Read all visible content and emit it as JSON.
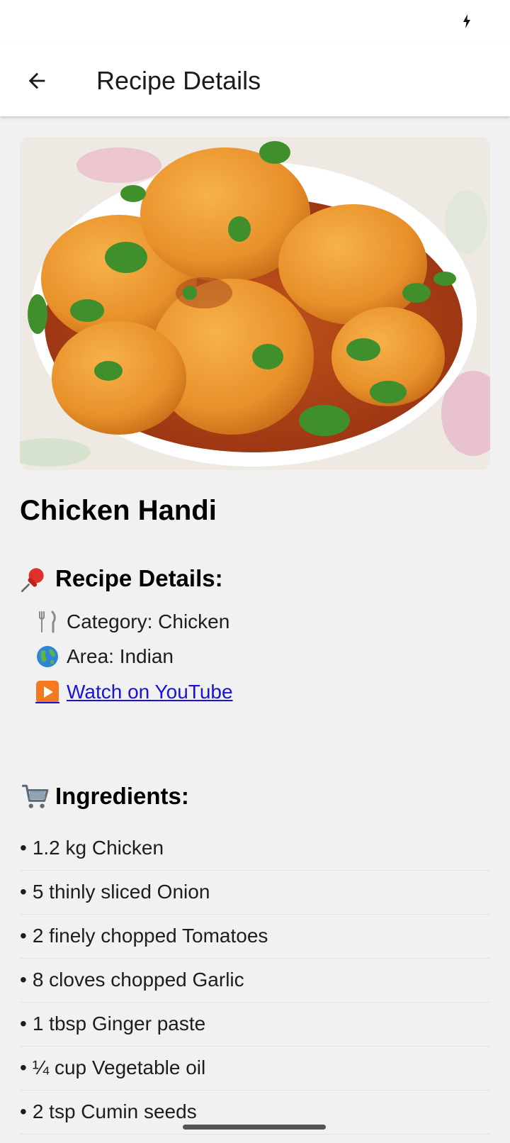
{
  "status_bar": {
    "icons": [
      "charging-bolt-icon"
    ]
  },
  "app_bar": {
    "title": "Recipe Details",
    "back_icon": "arrow-left-icon"
  },
  "recipe": {
    "name": "Chicken Handi",
    "image": "chicken-handi-photo"
  },
  "details_section": {
    "heading": "Recipe Details:",
    "heading_icon": "pushpin-icon",
    "category": "Category: Chicken",
    "category_icon": "fork-knife-icon",
    "area": "Area: Indian",
    "area_icon": "globe-icon",
    "youtube_label": "Watch on YouTube",
    "youtube_icon": "play-button-icon"
  },
  "ingredients_section": {
    "heading": "Ingredients:",
    "heading_icon": "shopping-cart-icon",
    "items": [
      "1.2 kg Chicken",
      "5 thinly sliced Onion",
      "2 finely chopped Tomatoes",
      "8 cloves chopped Garlic",
      "1 tbsp Ginger paste",
      "¼ cup Vegetable oil",
      "2 tsp Cumin seeds"
    ],
    "bullet": "•"
  },
  "colors": {
    "background": "#f1f1f1",
    "app_bar": "#ffffff",
    "link": "#1a12d8",
    "text": "#111111"
  }
}
